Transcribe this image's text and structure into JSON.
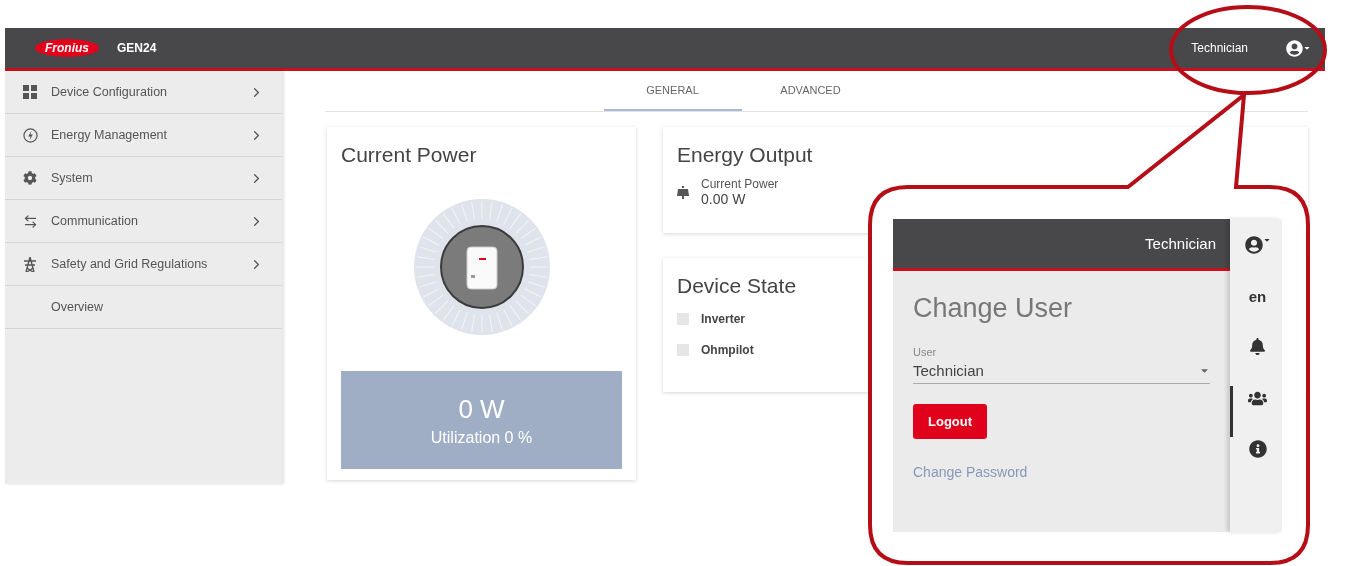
{
  "header": {
    "logo": "Fronius",
    "product": "GEN24",
    "user": "Technician"
  },
  "sidebar": {
    "items": [
      {
        "label": "Device Configuration",
        "kind": "group"
      },
      {
        "label": "Energy Management",
        "kind": "group"
      },
      {
        "label": "System",
        "kind": "group"
      },
      {
        "label": "Communication",
        "kind": "group"
      },
      {
        "label": "Safety and Grid Regulations",
        "kind": "group"
      },
      {
        "label": "Overview",
        "kind": "link"
      }
    ]
  },
  "tabs": [
    {
      "label": "GENERAL",
      "selected": true
    },
    {
      "label": "ADVANCED",
      "selected": false
    }
  ],
  "current_power": {
    "title": "Current Power",
    "value": "0 W",
    "utilization": "Utilization 0 %"
  },
  "energy_output": {
    "title": "Energy Output",
    "label": "Current Power",
    "value": "0.00 W"
  },
  "device_state": {
    "title": "Device State",
    "devices": [
      {
        "name": "Inverter"
      },
      {
        "name": "Ohmpilot"
      }
    ]
  },
  "callout": {
    "header_user": "Technician",
    "title": "Change User",
    "user_field": {
      "label": "User",
      "value": "Technician"
    },
    "logout": "Logout",
    "change_password": "Change Password",
    "rail": [
      {
        "kind": "user",
        "selected": false
      },
      {
        "kind": "language",
        "label": "en",
        "selected": false
      },
      {
        "kind": "bell",
        "selected": false
      },
      {
        "kind": "users",
        "selected": true
      },
      {
        "kind": "info",
        "selected": false
      }
    ]
  }
}
